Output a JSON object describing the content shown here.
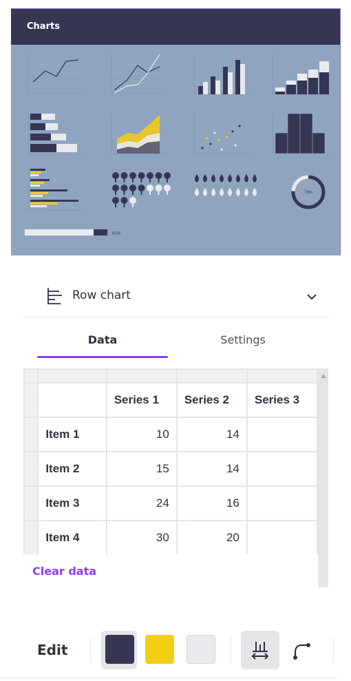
{
  "preview": {
    "title": "Charts",
    "progress_label": "81%",
    "donut_label": "76%",
    "colors": {
      "navy": "#353654",
      "yellow": "#f3ce13",
      "light": "#e9eaee",
      "panel": "#8fa5bf"
    }
  },
  "chart_type": {
    "label": "Row chart",
    "icon": "row-chart-icon",
    "expand_icon": "chevron-down-icon"
  },
  "tabs": [
    {
      "label": "Data",
      "active": true
    },
    {
      "label": "Settings",
      "active": false
    }
  ],
  "table": {
    "columns": [
      "Series 1",
      "Series 2",
      "Series 3"
    ],
    "rows": [
      {
        "label": "Item 1",
        "values": [
          "10",
          "14",
          ""
        ]
      },
      {
        "label": "Item 2",
        "values": [
          "15",
          "14",
          ""
        ]
      },
      {
        "label": "Item 3",
        "values": [
          "24",
          "16",
          ""
        ]
      },
      {
        "label": "Item 4",
        "values": [
          "30",
          "20",
          ""
        ]
      }
    ]
  },
  "clear_label": "Clear data",
  "toolbar": {
    "edit_label": "Edit",
    "swatches": [
      {
        "color": "#353654",
        "selected": true
      },
      {
        "color": "#f3ce13",
        "selected": false
      },
      {
        "color": "#e9eaee",
        "selected": false
      }
    ],
    "spacing_icon": "bar-spacing-icon",
    "corner_icon": "corner-rounding-icon"
  }
}
